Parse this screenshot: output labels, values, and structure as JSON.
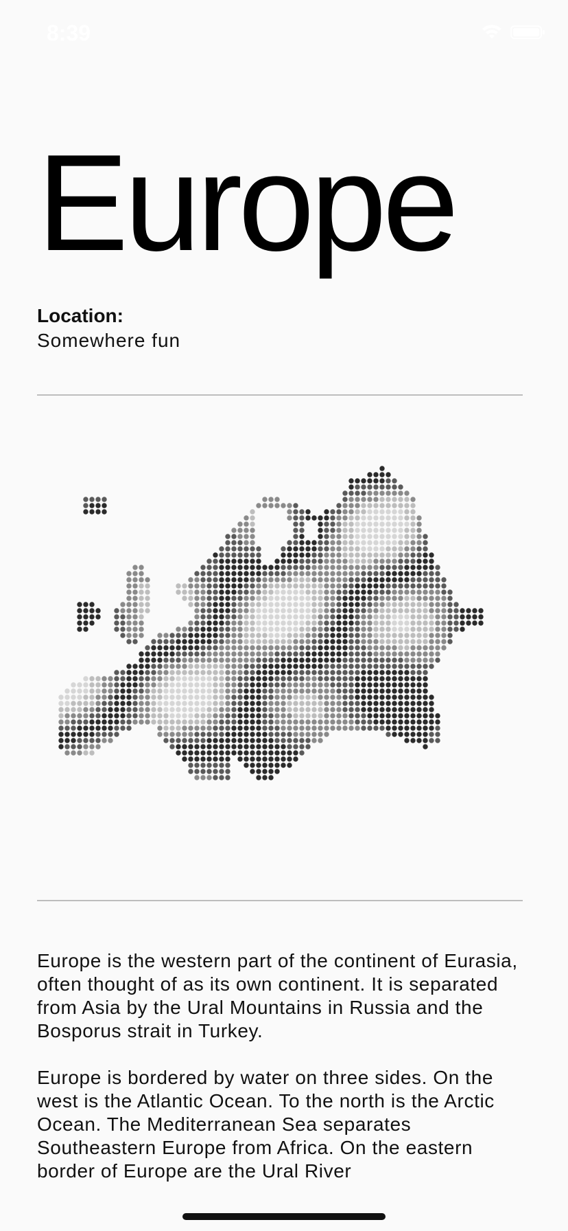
{
  "status_bar": {
    "time": "8:39",
    "icons": [
      "wifi-icon",
      "battery-icon"
    ]
  },
  "page": {
    "title": "Europe",
    "location_label": "Location:",
    "location_value": "Somewhere fun"
  },
  "map": {
    "icon": "europe-dot-map",
    "colors": [
      "#2b2b2b",
      "#5a5a5a",
      "#8a8a8a",
      "#bdbdbd",
      "#d6d6d6"
    ]
  },
  "content": {
    "paragraphs": [
      "Europe is the western part of the continent of Eurasia, often thought of as its own continent. It is separated from Asia by the Ural Mountains in Russia and the Bosporus strait in Turkey.",
      "Europe is bordered by water on three sides. On the west is the Atlantic Ocean. To the north is the Arctic Ocean. The Mediterranean Sea separates Southeastern Europe from Africa. On the eastern border of Europe are the Ural River"
    ]
  }
}
